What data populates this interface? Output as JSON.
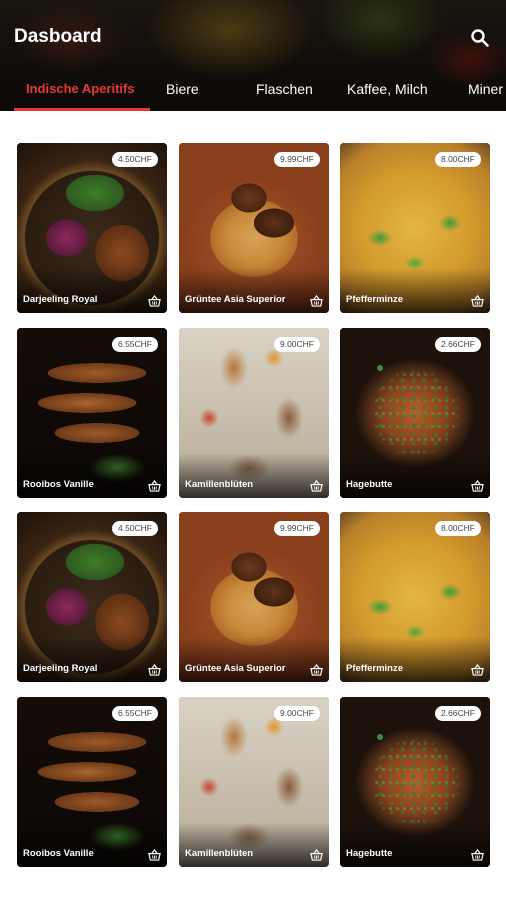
{
  "header": {
    "title": "Dasboard",
    "search_icon": "search-icon"
  },
  "tabs": [
    {
      "label": "Indische Aperitifs",
      "active": true
    },
    {
      "label": "Biere",
      "active": false
    },
    {
      "label": "Flaschen",
      "active": false
    },
    {
      "label": "Kaffee, Milch",
      "active": false
    },
    {
      "label": "Miner",
      "active": false
    }
  ],
  "colors": {
    "accent": "#e53935",
    "text_on_dark": "#ffffff"
  },
  "products": [
    {
      "name": "Darjeeling Royal",
      "price": "4.50CHF",
      "image": "food-a"
    },
    {
      "name": "Grüntee Asia Superior",
      "price": "9.99CHF",
      "image": "food-b"
    },
    {
      "name": "Pfefferminze",
      "price": "8.00CHF",
      "image": "food-c"
    },
    {
      "name": "Rooibos Vanille",
      "price": "6.55CHF",
      "image": "food-d"
    },
    {
      "name": "Kamillenblüten",
      "price": "9.00CHF",
      "image": "food-e"
    },
    {
      "name": "Hagebutte",
      "price": "2.66CHF",
      "image": "food-f"
    },
    {
      "name": "Darjeeling Royal",
      "price": "4.50CHF",
      "image": "food-a"
    },
    {
      "name": "Grüntee Asia Superior",
      "price": "9.99CHF",
      "image": "food-b"
    },
    {
      "name": "Pfefferminze",
      "price": "8.00CHF",
      "image": "food-c"
    },
    {
      "name": "Rooibos Vanille",
      "price": "6.55CHF",
      "image": "food-d"
    },
    {
      "name": "Kamillenblüten",
      "price": "9.00CHF",
      "image": "food-e"
    },
    {
      "name": "Hagebutte",
      "price": "2.66CHF",
      "image": "food-f"
    }
  ]
}
